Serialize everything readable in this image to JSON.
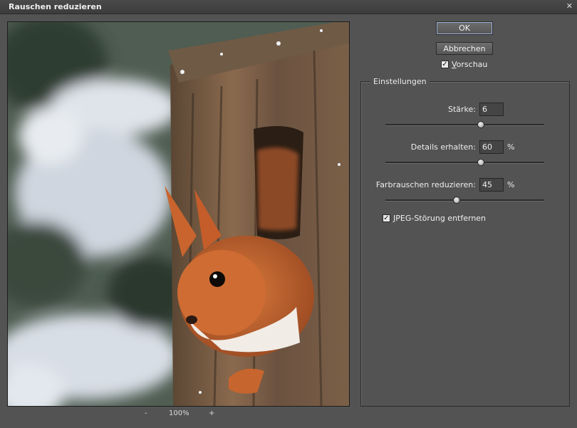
{
  "window": {
    "title": "Rauschen reduzieren",
    "close_glyph": "✕"
  },
  "buttons": {
    "ok": "OK",
    "cancel": "Abbrechen"
  },
  "preview_check": {
    "label_first": "V",
    "label_rest": "orschau",
    "checked": true
  },
  "zoom": {
    "minus": "-",
    "value": "100%",
    "plus": "+"
  },
  "settings": {
    "title": "Einstellungen",
    "strength": {
      "label": "Stärke:",
      "value": "6",
      "level": 0.6
    },
    "details": {
      "label": "Details erhalten:",
      "value": "60",
      "unit": "%",
      "level": 0.6
    },
    "color_noise": {
      "label": "Farbrauschen reduzieren:",
      "value": "45",
      "unit": "%",
      "level": 0.45
    },
    "jpeg": {
      "label_first": "J",
      "label_rest": "PEG-Störung entfernen",
      "checked": true
    }
  },
  "colors": {
    "background": "#535353",
    "titlebar": "#3c3c3c",
    "ok_focus": "#9ab0d8"
  }
}
